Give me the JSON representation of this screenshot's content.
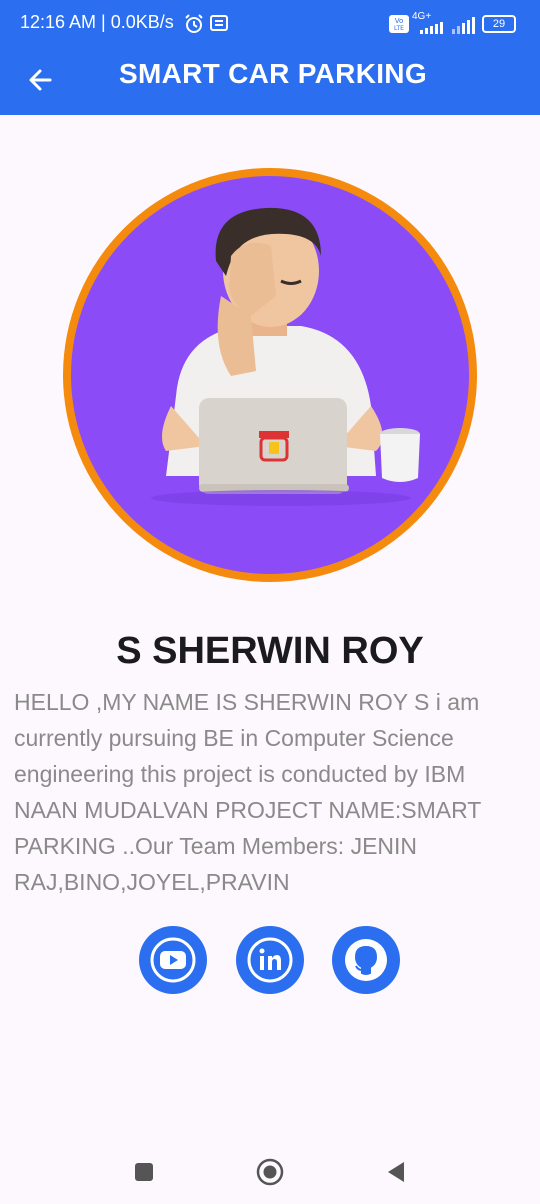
{
  "status_bar": {
    "time": "12:16 AM | 0.0KB/s",
    "battery": "29",
    "network": "4G+"
  },
  "app_bar": {
    "title": "SMART CAR PARKING",
    "back_icon": "arrow-left-icon"
  },
  "profile": {
    "name": "S SHERWIN ROY",
    "bio": "HELLO ,MY NAME IS SHERWIN ROY S i am currently pursuing BE in Computer Science engineering this project is conducted by IBM NAAN MUDALVAN PROJECT NAME:SMART PARKING ..Our Team Members: JENIN RAJ,BINO,JOYEL,PRAVIN"
  },
  "social": [
    {
      "icon": "youtube-icon"
    },
    {
      "icon": "linkedin-icon"
    },
    {
      "icon": "github-icon"
    }
  ],
  "colors": {
    "primary": "#2b6ff0",
    "avatar_ring": "#f58b0e",
    "avatar_bg": "#8b4cf7",
    "bio_text": "#8a8a8a"
  }
}
